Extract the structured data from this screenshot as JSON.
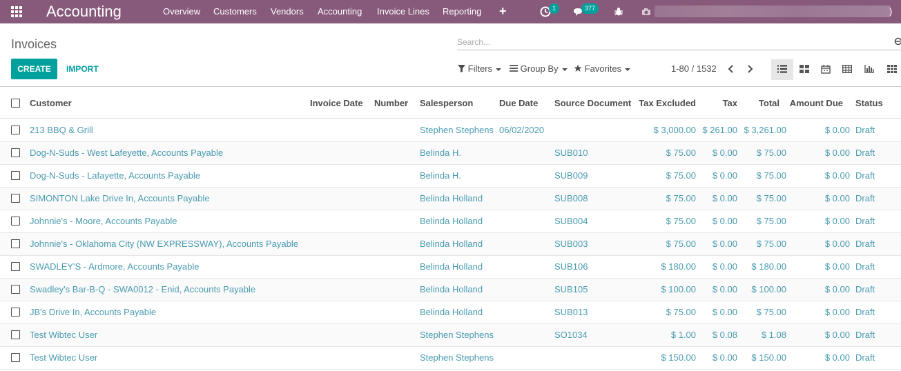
{
  "app": {
    "title": "Accounting"
  },
  "nav": {
    "menu": [
      "Overview",
      "Customers",
      "Vendors",
      "Accounting",
      "Invoice Lines",
      "Reporting"
    ],
    "plus_label": "+",
    "activity_badge": "1",
    "messages_badge": "377",
    "user_tail": ")"
  },
  "control_panel": {
    "breadcrumb": "Invoices",
    "search_placeholder": "Search...",
    "create_label": "CREATE",
    "import_label": "IMPORT",
    "filters_label": "Filters",
    "groupby_label": "Group By",
    "favorites_label": "Favorites",
    "pager": "1-80 / 1532",
    "views": [
      "list-view-icon",
      "kanban-view-icon",
      "calendar-view-icon",
      "pivot-view-icon",
      "graph-view-icon",
      "activity-view-icon"
    ],
    "active_view": "list-view-icon"
  },
  "table": {
    "headers": {
      "customer": "Customer",
      "invoice_date": "Invoice Date",
      "number": "Number",
      "salesperson": "Salesperson",
      "due_date": "Due Date",
      "source": "Source Document",
      "tax_excluded": "Tax Excluded",
      "tax": "Tax",
      "total": "Total",
      "amount_due": "Amount Due",
      "status": "Status"
    },
    "rows": [
      {
        "customer": "213 BBQ & Grill",
        "invoice_date": "",
        "number": "",
        "salesperson": "Stephen Stephens",
        "due_date": "06/02/2020",
        "source": "",
        "tax_excluded": "$ 3,000.00",
        "tax": "$ 261.00",
        "total": "$ 3,261.00",
        "amount_due": "$ 0.00",
        "status": "Draft"
      },
      {
        "customer": "Dog-N-Suds - West Lafeyette, Accounts Payable",
        "invoice_date": "",
        "number": "",
        "salesperson": "Belinda H.",
        "due_date": "",
        "source": "SUB010",
        "tax_excluded": "$ 75.00",
        "tax": "$ 0.00",
        "total": "$ 75.00",
        "amount_due": "$ 0.00",
        "status": "Draft"
      },
      {
        "customer": "Dog-N-Suds - Lafayette, Accounts Payable",
        "invoice_date": "",
        "number": "",
        "salesperson": "Belinda H.",
        "due_date": "",
        "source": "SUB009",
        "tax_excluded": "$ 75.00",
        "tax": "$ 0.00",
        "total": "$ 75.00",
        "amount_due": "$ 0.00",
        "status": "Draft"
      },
      {
        "customer": "SIMONTON Lake Drive In, Accounts Payable",
        "invoice_date": "",
        "number": "",
        "salesperson": "Belinda Holland",
        "due_date": "",
        "source": "SUB008",
        "tax_excluded": "$ 75.00",
        "tax": "$ 0.00",
        "total": "$ 75.00",
        "amount_due": "$ 0.00",
        "status": "Draft"
      },
      {
        "customer": "Johnnie's - Moore, Accounts Payable",
        "invoice_date": "",
        "number": "",
        "salesperson": "Belinda Holland",
        "due_date": "",
        "source": "SUB004",
        "tax_excluded": "$ 75.00",
        "tax": "$ 0.00",
        "total": "$ 75.00",
        "amount_due": "$ 0.00",
        "status": "Draft"
      },
      {
        "customer": "Johnnie's - Oklahoma City (NW EXPRESSWAY), Accounts Payable",
        "invoice_date": "",
        "number": "",
        "salesperson": "Belinda Holland",
        "due_date": "",
        "source": "SUB003",
        "tax_excluded": "$ 75.00",
        "tax": "$ 0.00",
        "total": "$ 75.00",
        "amount_due": "$ 0.00",
        "status": "Draft"
      },
      {
        "customer": "SWADLEY'S - Ardmore, Accounts Payable",
        "invoice_date": "",
        "number": "",
        "salesperson": "Belinda Holland",
        "due_date": "",
        "source": "SUB106",
        "tax_excluded": "$ 180.00",
        "tax": "$ 0.00",
        "total": "$ 180.00",
        "amount_due": "$ 0.00",
        "status": "Draft"
      },
      {
        "customer": "Swadley's Bar-B-Q - SWA0012 - Enid, Accounts Payable",
        "invoice_date": "",
        "number": "",
        "salesperson": "Belinda Holland",
        "due_date": "",
        "source": "SUB105",
        "tax_excluded": "$ 100.00",
        "tax": "$ 0.00",
        "total": "$ 100.00",
        "amount_due": "$ 0.00",
        "status": "Draft"
      },
      {
        "customer": "JB's Drive In, Accounts Payable",
        "invoice_date": "",
        "number": "",
        "salesperson": "Belinda Holland",
        "due_date": "",
        "source": "SUB013",
        "tax_excluded": "$ 75.00",
        "tax": "$ 0.00",
        "total": "$ 75.00",
        "amount_due": "$ 0.00",
        "status": "Draft"
      },
      {
        "customer": "Test Wibtec User",
        "invoice_date": "",
        "number": "",
        "salesperson": "Stephen Stephens",
        "due_date": "",
        "source": "SO1034",
        "tax_excluded": "$ 1.00",
        "tax": "$ 0.08",
        "total": "$ 1.08",
        "amount_due": "$ 0.00",
        "status": "Draft"
      },
      {
        "customer": "Test Wibtec User",
        "invoice_date": "",
        "number": "",
        "salesperson": "Stephen Stephens",
        "due_date": "",
        "source": "",
        "tax_excluded": "$ 150.00",
        "tax": "$ 0.00",
        "total": "$ 150.00",
        "amount_due": "$ 0.00",
        "status": "Draft"
      }
    ]
  },
  "colors": {
    "navbar": "#875a7b",
    "accent": "#00a09d",
    "link": "#4a9bb0"
  }
}
